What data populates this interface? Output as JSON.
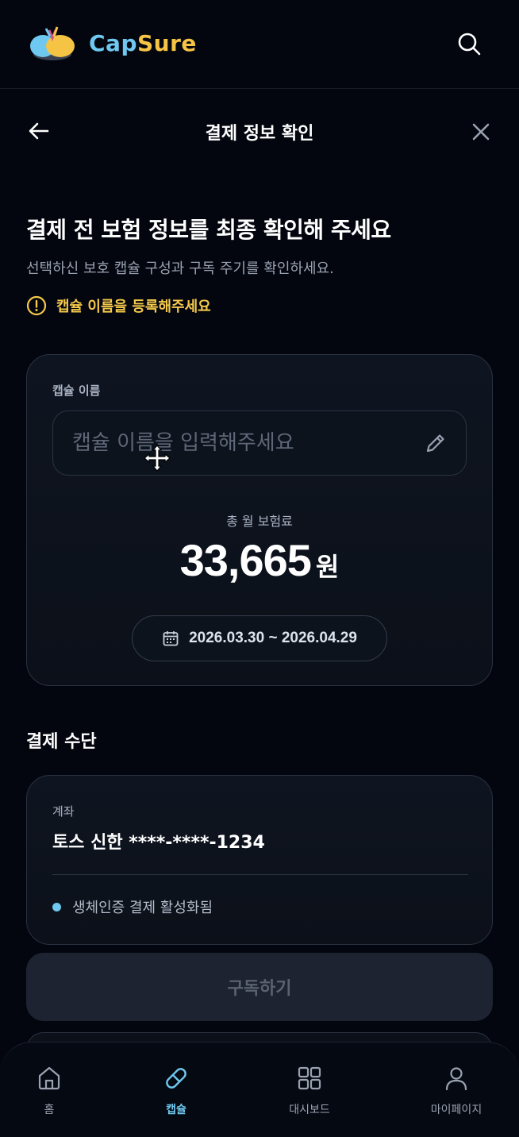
{
  "header": {
    "brand_cap": "Cap",
    "brand_sure": "Sure"
  },
  "subheader": {
    "title": "결제 정보 확인"
  },
  "intro": {
    "headline": "결제 전 보험 정보를 최종 확인해 주세요",
    "subtitle": "선택하신 보호 캡슐 구성과 구독 주기를 확인하세요.",
    "warning": "캡슐 이름을 등록해주세요"
  },
  "capsule_card": {
    "name_label": "캡슐 이름",
    "name_value": "",
    "name_placeholder": "캡슐 이름을 입력해주세요",
    "premium_label": "총 월 보험료",
    "premium_value": "33,665",
    "premium_unit": "원",
    "period": "2026.03.30 ~ 2026.04.29"
  },
  "payment": {
    "section_title": "결제 수단",
    "type_label": "계좌",
    "account": "토스 신한 ****-****-1234",
    "biometric_status": "생체인증 결제 활성화됨"
  },
  "subscribe_button": "구독하기",
  "bottom_nav": {
    "items": [
      {
        "label": "홈",
        "icon": "home-icon",
        "active": false
      },
      {
        "label": "캡슐",
        "icon": "pill-icon",
        "active": true
      },
      {
        "label": "대시보드",
        "icon": "dashboard-icon",
        "active": false
      },
      {
        "label": "마이페이지",
        "icon": "user-icon",
        "active": false
      }
    ]
  },
  "colors": {
    "background": "#03060f",
    "accent_blue": "#6fc8f0",
    "accent_yellow": "#f5c445",
    "warning": "#f5c94a"
  }
}
